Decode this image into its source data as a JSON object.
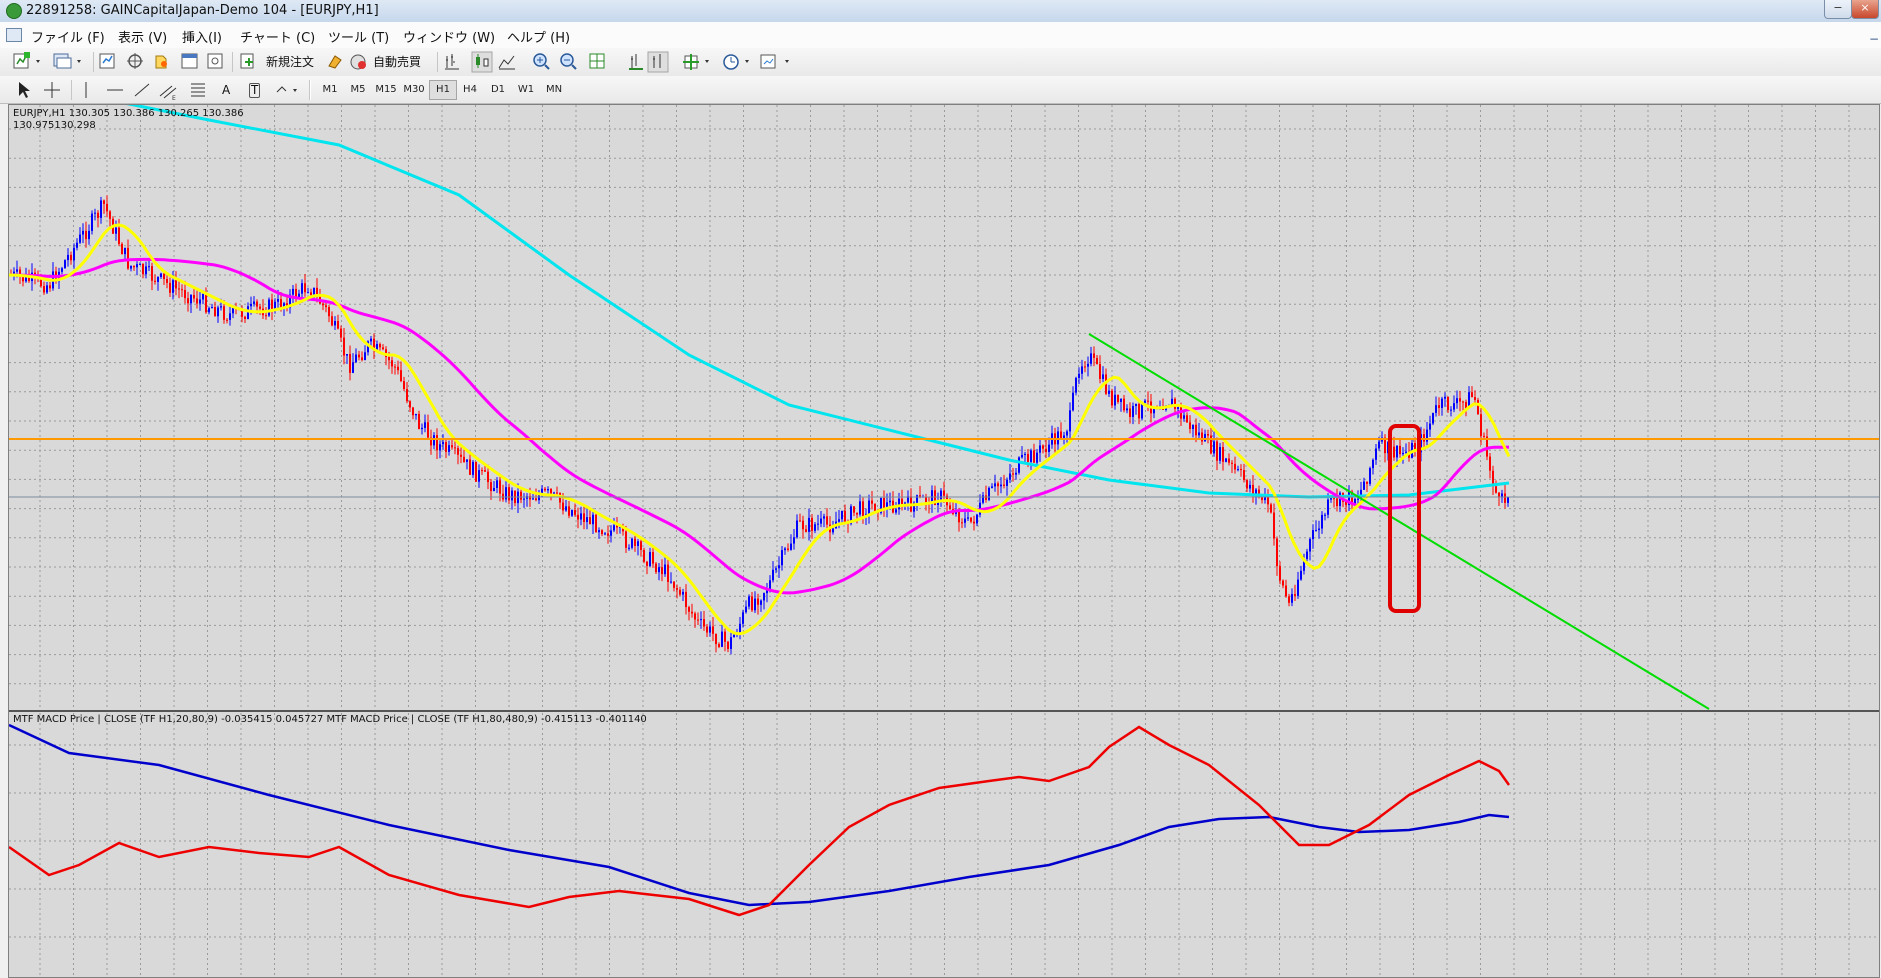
{
  "window": {
    "title": "22891258: GAINCapitalJapan-Demo 104 - [EURJPY,H1]",
    "controls": [
      "−",
      "□",
      "×"
    ]
  },
  "menu": {
    "items": [
      "ファイル (F)",
      "表示 (V)",
      "挿入(I)",
      "チャート (C)",
      "ツール (T)",
      "ウィンドウ (W)",
      "ヘルプ (H)"
    ],
    "mdi_controls": [
      "−",
      "□"
    ]
  },
  "toolbar1": {
    "new_order_label": "新規注文",
    "auto_trade_label": "自動売買"
  },
  "toolbar2": {
    "timeframes": [
      "M1",
      "M5",
      "M15",
      "M30",
      "H1",
      "H4",
      "D1",
      "W1",
      "MN"
    ],
    "active_timeframe": "H1",
    "text_tool_label": "A",
    "text_label_tool_label": "T"
  },
  "chart": {
    "info_line1": "EURJPY,H1  130.305 130.386 130.265 130.386",
    "info_line2": "130.975130.298",
    "indicator_label": "MTF MACD Price | CLOSE  (TF H1,20,80,9) -0.035415 0.045727  MTF MACD Price | CLOSE  (TF H1,80,480,9) -0.415113 -0.401140",
    "colors": {
      "background": "#d9d9d9",
      "grid": "#9a9a9a",
      "bull_candle": "#0000ff",
      "bear_candle": "#ff0000",
      "ma_short": "#ffff00",
      "ma_mid": "#ff00ff",
      "ma_long": "#00e5ee",
      "horizontal_level": "#ff9900",
      "current_price_line": "#7a8aa0",
      "trendline": "#00dd00",
      "highlight_box": "#e00000",
      "macd_fast": "#ee0000",
      "macd_slow": "#0000cc"
    }
  }
}
